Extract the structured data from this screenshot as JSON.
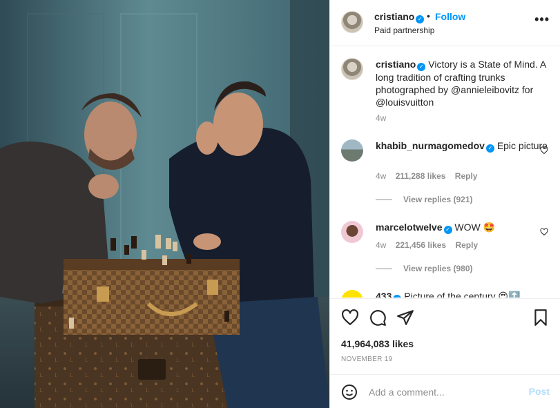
{
  "post": {
    "author": "cristiano",
    "header": {
      "separator": "•",
      "follow_label": "Follow",
      "subtitle": "Paid partnership",
      "more_icon": "more-horizontal-icon"
    },
    "caption": {
      "author": "cristiano",
      "text": "Victory is a State of Mind. A long tradition of crafting trunks photographed by @annieleibovitz for @louisvuitton",
      "age": "4w"
    },
    "comments": [
      {
        "user": "khabib_nurmagomedov",
        "text": "Epic picture",
        "age": "4w",
        "likes": "211,288 likes",
        "reply_label": "Reply",
        "view_replies": "View replies (921)"
      },
      {
        "user": "marcelotwelve",
        "text": "WOW 🤩",
        "age": "4w",
        "likes": "221,456 likes",
        "reply_label": "Reply",
        "view_replies": "View replies (980)"
      },
      {
        "user": "433",
        "text": "Picture of the century 😍🔝",
        "age": "",
        "likes": "",
        "reply_label": "",
        "view_replies": ""
      }
    ],
    "likes_count": "41,964,083 likes",
    "date": "NOVEMBER 19",
    "add_comment": {
      "placeholder": "Add a comment...",
      "post_label": "Post"
    },
    "colors": {
      "accent": "#0095f6",
      "post_disabled": "#b2dffc",
      "secondary_text": "#8e8e8e"
    }
  }
}
